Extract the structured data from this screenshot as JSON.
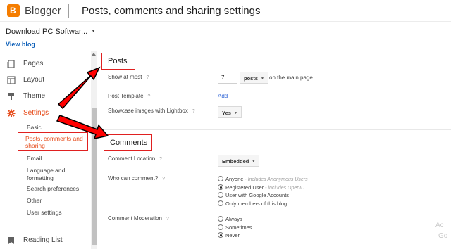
{
  "header": {
    "brand": "Blogger",
    "title": "Posts, comments and sharing settings",
    "logo_letter": "B"
  },
  "blog": {
    "name": "Download PC Softwar...",
    "view_blog": "View blog"
  },
  "sidebar": {
    "items": [
      {
        "label": "Pages",
        "icon": "pages-icon"
      },
      {
        "label": "Layout",
        "icon": "layout-icon"
      },
      {
        "label": "Theme",
        "icon": "theme-icon"
      },
      {
        "label": "Settings",
        "icon": "gear-icon",
        "active": true
      }
    ],
    "sub_items": [
      "Basic",
      "Posts, comments and sharing",
      "Email",
      "Language and formatting",
      "Search preferences",
      "Other",
      "User settings"
    ],
    "language_line1": "Language and",
    "language_line2": "formatting",
    "reading_list": "Reading List"
  },
  "posts": {
    "heading": "Posts",
    "show_at_most_label": "Show at most",
    "show_at_most_value": "7",
    "unit_label": "posts",
    "unit_suffix": "on the main page",
    "post_template_label": "Post Template",
    "post_template_link": "Add",
    "lightbox_label": "Showcase images with Lightbox",
    "lightbox_value": "Yes"
  },
  "comments": {
    "heading": "Comments",
    "location_label": "Comment Location",
    "location_value": "Embedded",
    "who_label": "Who can comment?",
    "who_options": [
      {
        "label": "Anyone",
        "note": " - Includes Anonymous Users",
        "checked": false
      },
      {
        "label": "Registered User",
        "note": " - includes OpenID",
        "checked": true
      },
      {
        "label": "User with Google Accounts",
        "note": "",
        "checked": false
      },
      {
        "label": "Only members of this blog",
        "note": "",
        "checked": false
      }
    ],
    "moderation_label": "Comment Moderation",
    "moderation_options": [
      {
        "label": "Always",
        "checked": false
      },
      {
        "label": "Sometimes",
        "checked": false
      },
      {
        "label": "Never",
        "checked": true
      }
    ]
  },
  "help_mark": "?",
  "watermark": {
    "line1": "Ac",
    "line2": "Go"
  },
  "colors": {
    "accent": "#e64a19",
    "annotation_red": "#e02020",
    "link": "#3367d6",
    "logo": "#f57d00"
  }
}
